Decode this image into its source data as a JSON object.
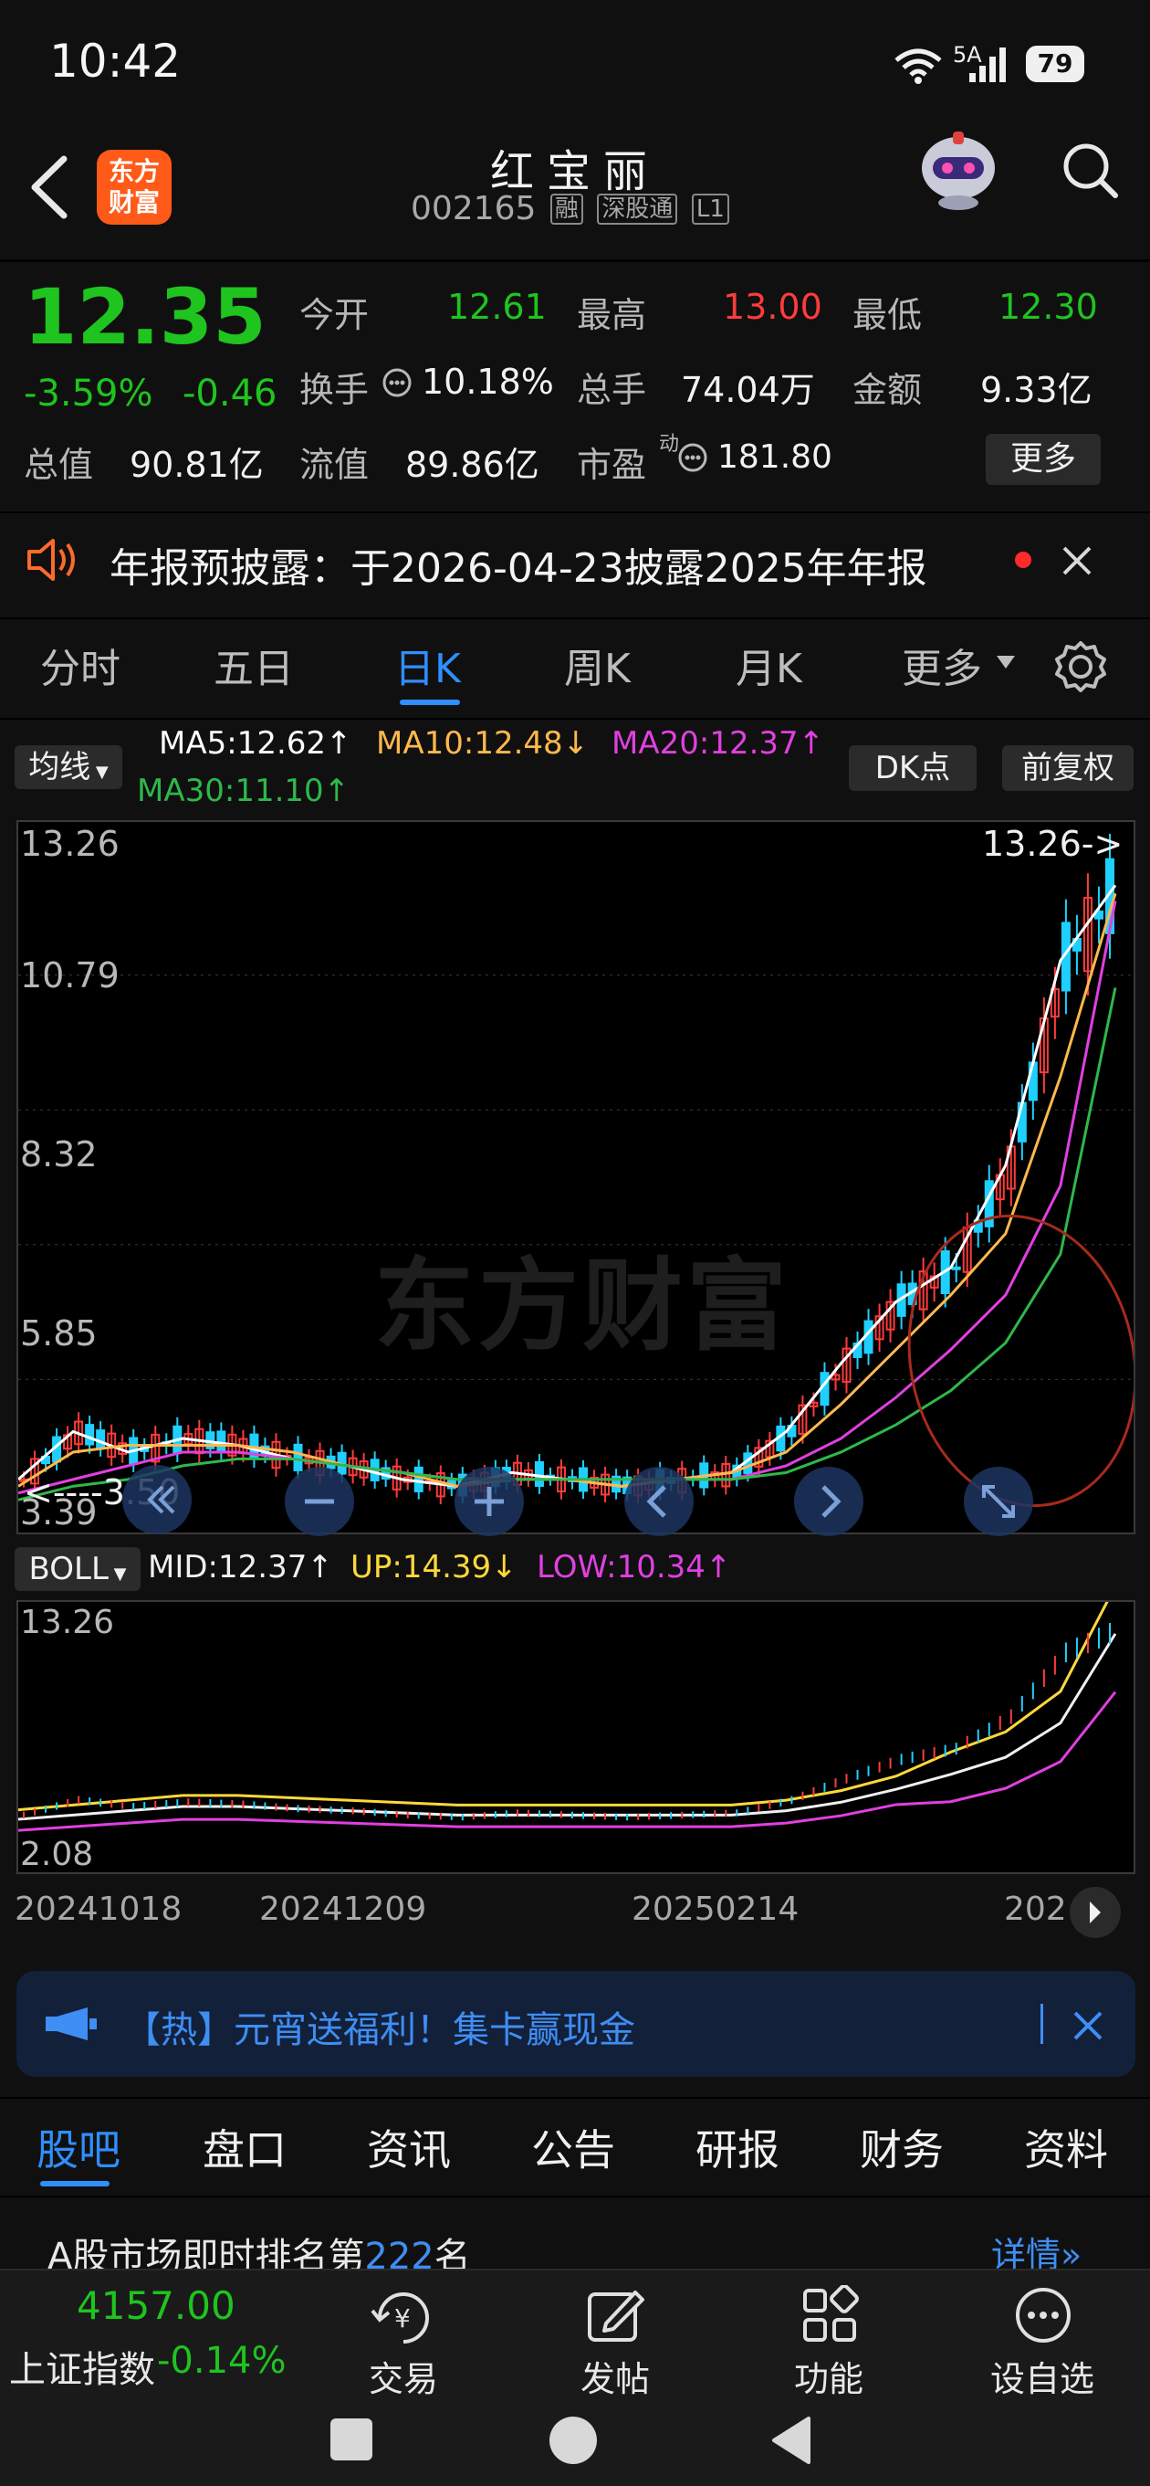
{
  "status": {
    "time": "10:42",
    "signal": "5A",
    "battery": "79"
  },
  "header": {
    "logo": "东方\n财富",
    "stock_name": "红宝丽",
    "stock_code": "002165",
    "tags": [
      "融",
      "深股通",
      "L1"
    ]
  },
  "quote": {
    "price": "12.35",
    "change_pct": "-3.59%",
    "change": "-0.46",
    "fields": [
      {
        "label": "今开",
        "value": "12.61"
      },
      {
        "label": "最高",
        "value": "13.00"
      },
      {
        "label": "最低",
        "value": "12.30"
      },
      {
        "label": "换手",
        "value": "10.18%"
      },
      {
        "label": "总手",
        "value": "74.04万"
      },
      {
        "label": "金额",
        "value": "9.33亿"
      },
      {
        "label": "总值",
        "value": "90.81亿"
      },
      {
        "label": "流值",
        "value": "89.86亿"
      },
      {
        "label": "市盈",
        "value": "181.80"
      }
    ],
    "pe_superscript": "动",
    "more_label": "更多"
  },
  "notice": {
    "text": "年报预披露：于2026-04-23披露2025年年报"
  },
  "period_tabs": [
    "分时",
    "五日",
    "日K",
    "周K",
    "月K",
    "更多"
  ],
  "period_active": "日K",
  "indicator": {
    "ma_button": "均线",
    "ma5": "MA5:12.62↑",
    "ma10": "MA10:12.48↓",
    "ma20": "MA20:12.37↑",
    "ma30": "MA30:11.10↑",
    "dk_button": "DK点",
    "adjust_button": "前复权",
    "colors": {
      "ma5": "#ffffff",
      "ma10": "#ffb84d",
      "ma20": "#e040e0",
      "ma30": "#2fb84a",
      "up": "#ff3b3b",
      "down": "#1fd0ff"
    }
  },
  "kline": {
    "y_labels": [
      "13.26",
      "10.79",
      "8.32",
      "5.85",
      "3.39"
    ],
    "max_label": "13.26->",
    "min_label": "<----3.50",
    "watermark": "东方财富"
  },
  "boll": {
    "button": "BOLL",
    "mid": "MID:12.37↑",
    "up": "UP:14.39↓",
    "low": "LOW:10.34↑",
    "y_top": "13.26",
    "y_bottom": "2.08"
  },
  "chart_data": {
    "type": "line",
    "title": "",
    "series": [
      {
        "name": "MA5",
        "values": [
          3.9,
          4.6,
          4.3,
          4.5,
          4.4,
          4.2,
          4.1,
          3.9,
          3.8,
          4.0,
          3.9,
          3.8,
          3.9,
          4.0,
          4.6,
          5.6,
          6.5,
          7.0,
          8.5,
          11.5,
          12.6
        ]
      },
      {
        "name": "MA10",
        "values": [
          3.8,
          4.3,
          4.4,
          4.4,
          4.4,
          4.3,
          4.1,
          4.0,
          3.8,
          3.9,
          3.9,
          3.8,
          3.9,
          4.0,
          4.3,
          5.0,
          5.8,
          6.6,
          7.5,
          9.8,
          12.48
        ]
      },
      {
        "name": "MA20",
        "values": [
          3.7,
          3.9,
          4.1,
          4.3,
          4.3,
          4.2,
          4.1,
          4.0,
          3.9,
          3.9,
          3.9,
          3.9,
          3.9,
          3.9,
          4.1,
          4.5,
          5.1,
          5.8,
          6.6,
          8.2,
          12.37
        ]
      },
      {
        "name": "MA30",
        "values": [
          3.6,
          3.8,
          3.9,
          4.1,
          4.2,
          4.2,
          4.1,
          4.0,
          3.9,
          3.9,
          3.9,
          3.9,
          3.9,
          3.9,
          4.0,
          4.3,
          4.7,
          5.2,
          5.9,
          7.2,
          11.1
        ]
      }
    ],
    "ylim": [
      3.39,
      13.26
    ],
    "x_tick_labels": [
      "20241018",
      "20241209",
      "20250214",
      "202"
    ]
  },
  "promo": {
    "text": "【热】元宵送福利！集卡赢现金"
  },
  "bottom_tabs": [
    "股吧",
    "盘口",
    "资讯",
    "公告",
    "研报",
    "财务",
    "资料"
  ],
  "rank": {
    "prefix": "A股市场即时排名第",
    "number": "222",
    "suffix": "名",
    "detail": "详情"
  },
  "index_bar": {
    "value": "4157.00",
    "name": "上证指数",
    "change": "-0.14%"
  },
  "nav": [
    "交易",
    "发帖",
    "功能",
    "设自选"
  ]
}
